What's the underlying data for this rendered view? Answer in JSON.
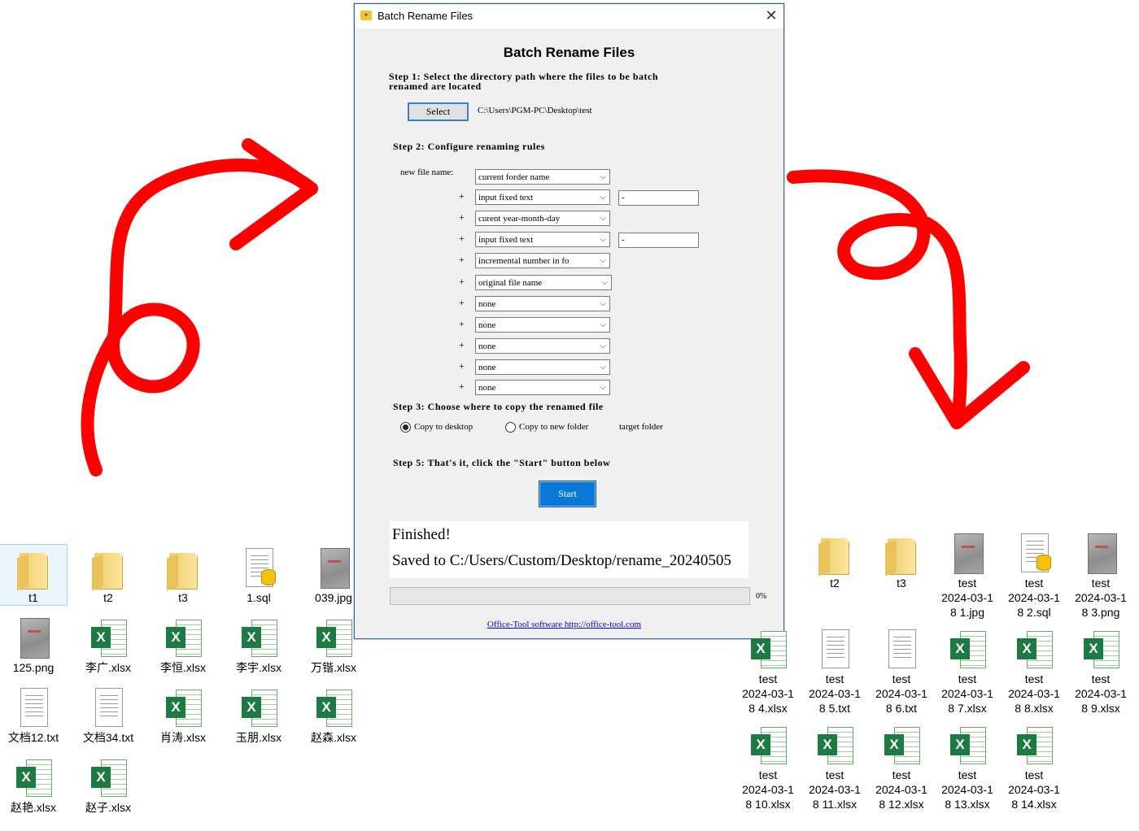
{
  "window": {
    "title": "Batch Rename Files",
    "close_glyph": "✕"
  },
  "heading": "Batch Rename Files",
  "step1": {
    "text_line1": "Step 1: Select the directory path where the files to be batch",
    "text_line2": "renamed are located",
    "select_label": "Select",
    "path": "C:\\Users\\PGM-PC\\Desktop\\test"
  },
  "step2": {
    "text": "Step 2: Configure renaming rules",
    "new_file_name_label": "new file name:",
    "plus": "+",
    "rules": [
      {
        "value": "current forder name"
      },
      {
        "value": "input fixed text",
        "text": "-"
      },
      {
        "value": "curent year-month-day"
      },
      {
        "value": "input fixed text",
        "text": "-"
      },
      {
        "value": "incremental number in fo"
      },
      {
        "value": "original file name"
      },
      {
        "value": "none"
      },
      {
        "value": "none"
      },
      {
        "value": "none"
      },
      {
        "value": "none"
      },
      {
        "value": "none"
      }
    ]
  },
  "step3": {
    "text": "Step 3: Choose where to copy the renamed file",
    "option_desktop": "Copy to desktop",
    "option_new_folder": "Copy to new folder",
    "target_folder": "target folder",
    "selected": "desktop"
  },
  "step5": {
    "text": "Step 5: That's it, click the \"Start\" button below"
  },
  "start_label": "Start",
  "output": {
    "line1": "Finished!",
    "line2": "Saved to C:/Users/Custom/Desktop/rename_20240505"
  },
  "progress": {
    "percent_label": "0%",
    "value": 0
  },
  "footer_link": "Office-Tool software http://office-tool.com",
  "colors": {
    "annotation_arrows": "#ff0000",
    "start_button": "#0a78d7",
    "window_border": "#2d6ab8"
  },
  "left_files": [
    {
      "name": "t1",
      "type": "folder"
    },
    {
      "name": "t2",
      "type": "folder"
    },
    {
      "name": "t3",
      "type": "folder"
    },
    {
      "name": "1.sql",
      "type": "sql"
    },
    {
      "name": "039.jpg",
      "type": "photo"
    },
    {
      "name": "125.png",
      "type": "photo"
    },
    {
      "name": "李广.xlsx",
      "type": "excel"
    },
    {
      "name": "李恒.xlsx",
      "type": "excel"
    },
    {
      "name": "李宇.xlsx",
      "type": "excel"
    },
    {
      "name": "万锴.xlsx",
      "type": "excel"
    },
    {
      "name": "文档12.txt",
      "type": "text"
    },
    {
      "name": "文档34.txt",
      "type": "text"
    },
    {
      "name": "肖涛.xlsx",
      "type": "excel"
    },
    {
      "name": "玉朋.xlsx",
      "type": "excel"
    },
    {
      "name": "赵森.xlsx",
      "type": "excel"
    },
    {
      "name": "赵艳.xlsx",
      "type": "excel"
    },
    {
      "name": "赵子.xlsx",
      "type": "excel"
    }
  ],
  "right_files": [
    {
      "name": "t2",
      "type": "folder"
    },
    {
      "name": "t3",
      "type": "folder"
    },
    {
      "name": "test\n2024-03-1\n8 1.jpg",
      "type": "photo"
    },
    {
      "name": "test\n2024-03-1\n8 2.sql",
      "type": "sql"
    },
    {
      "name": "test\n2024-03-1\n8 3.png",
      "type": "photo"
    },
    {
      "name": "test\n2024-03-1\n8 4.xlsx",
      "type": "excel"
    },
    {
      "name": "test\n2024-03-1\n8 5.txt",
      "type": "text"
    },
    {
      "name": "test\n2024-03-1\n8 6.txt",
      "type": "text"
    },
    {
      "name": "test\n2024-03-1\n8 7.xlsx",
      "type": "excel"
    },
    {
      "name": "test\n2024-03-1\n8 8.xlsx",
      "type": "excel"
    },
    {
      "name": "test\n2024-03-1\n8 9.xlsx",
      "type": "excel"
    },
    {
      "name": "test\n2024-03-1\n8 10.xlsx",
      "type": "excel"
    },
    {
      "name": "test\n2024-03-1\n8 11.xlsx",
      "type": "excel"
    },
    {
      "name": "test\n2024-03-1\n8 12.xlsx",
      "type": "excel"
    },
    {
      "name": "test\n2024-03-1\n8 13.xlsx",
      "type": "excel"
    },
    {
      "name": "test\n2024-03-1\n8 14.xlsx",
      "type": "excel"
    }
  ]
}
